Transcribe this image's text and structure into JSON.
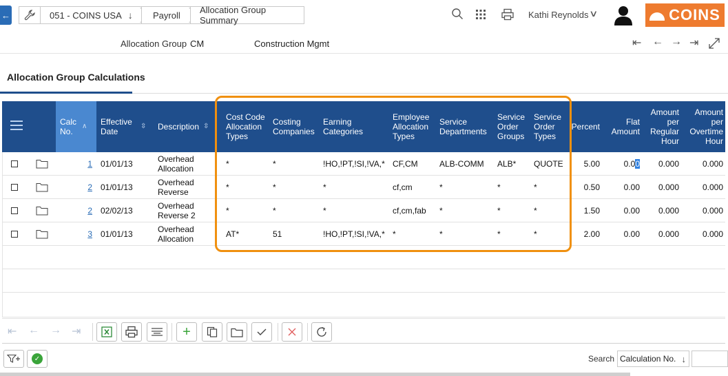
{
  "breadcrumb": {
    "company": "051 - COINS USA",
    "module": "Payroll",
    "current": "Allocation Group Summary"
  },
  "header_bar": {
    "user_name": "Kathi Reynolds",
    "logo_text": "COINS"
  },
  "record": {
    "field_label": "Allocation Group",
    "code": "CM",
    "description": "Construction Mgmt"
  },
  "tab": {
    "title": "Allocation Group Calculations"
  },
  "grid": {
    "columns": {
      "calc_no": "Calc No.",
      "effective_date": "Effective Date",
      "description": "Description",
      "cost_code_allocation_types": "Cost Code Allocation Types",
      "costing_companies": "Costing Companies",
      "earning_categories": "Earning Categories",
      "employee_allocation_types": "Employee Allocation Types",
      "service_departments": "Service Departments",
      "service_order_groups": "Service Order Groups",
      "service_order_types": "Service Order Types",
      "percent": "Percent",
      "flat_amount": "Flat Amount",
      "amount_per_regular_hour": "Amount per Regular Hour",
      "amount_per_overtime_hour": "Amount per Overtime Hour"
    },
    "rows": [
      {
        "calc_no": "1",
        "effective_date": "01/01/13",
        "description": "Overhead Allocation",
        "cost_code": "*",
        "costing_companies": "*",
        "earning_categories": "!HO,!PT,!SI,!VA,*",
        "employee_alloc": "CF,CM",
        "service_depts": "ALB-COMM",
        "so_groups": "ALB*",
        "so_types": "QUOTE",
        "percent": "5.00",
        "flat_amount_main": "0.0",
        "flat_amount_sel": "0",
        "amt_regular": "0.000",
        "amt_overtime": "0.000"
      },
      {
        "calc_no": "2",
        "effective_date": "01/01/13",
        "description": "Overhead Reverse",
        "cost_code": "*",
        "costing_companies": "*",
        "earning_categories": "*",
        "employee_alloc": "cf,cm",
        "service_depts": "*",
        "so_groups": "*",
        "so_types": "*",
        "percent": "0.50",
        "flat_amount_main": "0.00",
        "flat_amount_sel": "",
        "amt_regular": "0.000",
        "amt_overtime": "0.000"
      },
      {
        "calc_no": "2",
        "effective_date": "02/02/13",
        "description": "Overhead Reverse 2",
        "cost_code": "*",
        "costing_companies": "*",
        "earning_categories": "*",
        "employee_alloc": "cf,cm,fab",
        "service_depts": "*",
        "so_groups": "*",
        "so_types": "*",
        "percent": "1.50",
        "flat_amount_main": "0.00",
        "flat_amount_sel": "",
        "amt_regular": "0.000",
        "amt_overtime": "0.000"
      },
      {
        "calc_no": "3",
        "effective_date": "01/01/13",
        "description": "Overhead Allocation",
        "cost_code": "AT*",
        "costing_companies": "51",
        "earning_categories": "!HO,!PT,!SI,!VA,*",
        "employee_alloc": "*",
        "service_depts": "*",
        "so_groups": "*",
        "so_types": "*",
        "percent": "2.00",
        "flat_amount_main": "0.00",
        "flat_amount_sel": "",
        "amt_regular": "0.000",
        "amt_overtime": "0.000"
      }
    ]
  },
  "footer": {
    "search_label": "Search",
    "search_field": "Calculation No."
  },
  "colors": {
    "header_blue": "#1f4e8c",
    "sorted_column": "#4a88d0",
    "highlight_orange": "#f0900f",
    "brand_orange": "#ee7b2f"
  }
}
